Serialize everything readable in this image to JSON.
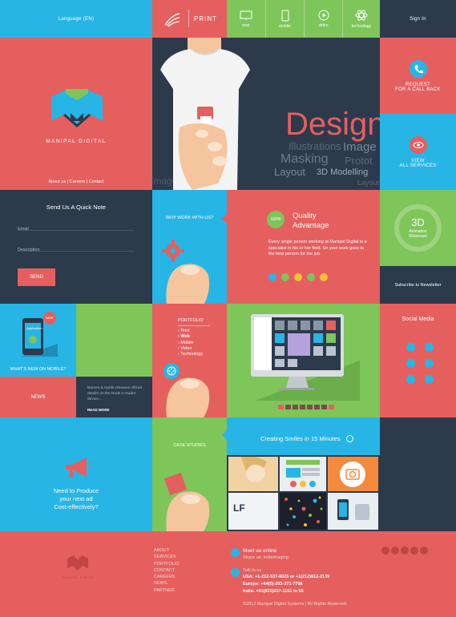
{
  "header": {
    "language": "Language (EN)",
    "print": "PRINT",
    "nav": [
      "web",
      "mobile",
      "video",
      "technology"
    ],
    "signin": "Sign In"
  },
  "brand": {
    "name": "MANIPAL DIGITAL",
    "links": [
      "About us",
      "|",
      "Careers",
      "|",
      "Contact"
    ]
  },
  "hero": {
    "words": [
      "Design",
      "Image",
      "Illustrations",
      "Masking",
      "Protot",
      "Layout",
      "3D Modelling",
      "Layout",
      "Image"
    ]
  },
  "callback": {
    "label1": "REQUEST",
    "label2": "FOR A CALL BACK"
  },
  "services": {
    "label1": "VIEW",
    "label2": "ALL SERVICES"
  },
  "note": {
    "title": "Send Us A Quick Note",
    "email": "Email",
    "description": "Description",
    "send": "SEND"
  },
  "why": {
    "label": "WHY WORK WITH US?"
  },
  "quality": {
    "badge": "100%",
    "title1": "Quality",
    "title2": "Advantage",
    "text": "Every single person working at Manipal Digital is a specialist in his or her field. So your work goes to the best person for the job."
  },
  "threeD": {
    "title": "3D",
    "sub1": "Animation",
    "sub2": "Showcase"
  },
  "subscribe": "Subscribe to Newsletter",
  "mobile": {
    "badge": "NEW",
    "app": "Application",
    "label": "WHAT'S NEW ON MOBILE?"
  },
  "portfolio": {
    "title": "PORTFOLIO",
    "items": [
      "Print",
      "Web",
      "Mobile",
      "Video",
      "Technology"
    ]
  },
  "social": {
    "title": "Social Media"
  },
  "news": {
    "label": "NEWS",
    "text": "Barnes & Noble releases official details on the Nook e-reader device...",
    "more": "READ MORE"
  },
  "case": {
    "label": "CASE STUDIES"
  },
  "smiles": {
    "title": "Creating Smiles in 15 Minutes"
  },
  "produce": {
    "line1": "Need to Produce",
    "line2": "your next ad",
    "line3": "Cost-effectively?"
  },
  "footer": {
    "links": [
      "ABOUT",
      "SERVICES",
      "PORTFOLIO",
      "CONTACT",
      "CAREERS",
      "NEWS",
      "PARTNER"
    ],
    "meet": "Meet us online",
    "skype": "Skype us: Indiaimaging",
    "talk": "Talk to us",
    "usa": "USA: +1-212-537-6025 or +1(212)812-2139",
    "europe": "Europe: +44(0)-203-371-7708",
    "india": "India: +91(820)257-1151 to 55",
    "copyright": "©2012 Manipal Digital Systems  |  All Rights Reserved.",
    "brand": "MANIPAL DIGITAL"
  },
  "colors": {
    "navy": "#2d3a4c",
    "coral": "#e55f5f",
    "cyan": "#27b5e5",
    "green": "#7ec55a"
  }
}
